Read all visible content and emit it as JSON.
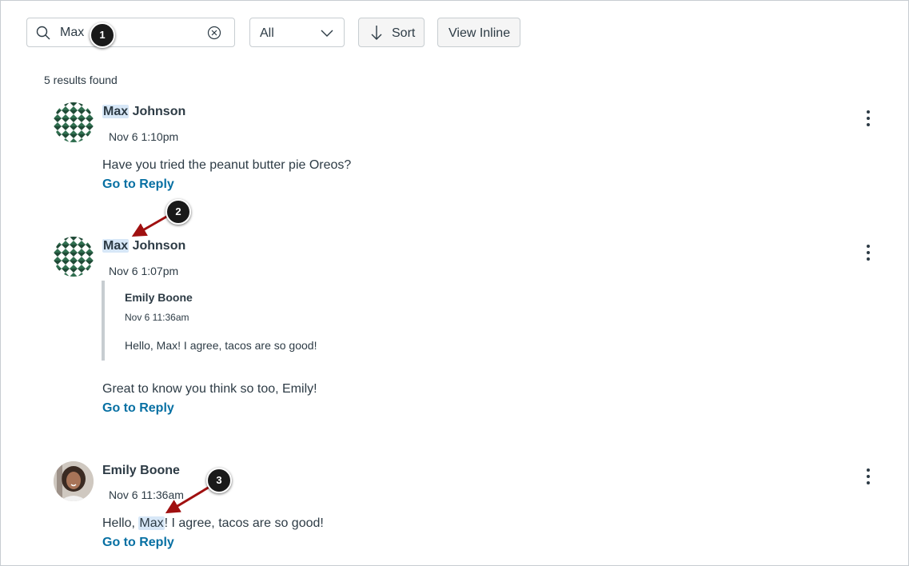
{
  "toolbar": {
    "search_value": "Max",
    "filter_selected": "All",
    "sort_label": "Sort",
    "view_inline_label": "View Inline"
  },
  "results_count": "5 results found",
  "entries": [
    {
      "author_highlight": "Max",
      "author_rest": " Johnson",
      "date": "Nov 6 1:10pm",
      "message": "Have you tried the peanut butter pie Oreos?",
      "reply_link": "Go to Reply"
    },
    {
      "author_highlight": "Max",
      "author_rest": " Johnson",
      "date": "Nov 6 1:07pm",
      "quote": {
        "author": "Emily Boone",
        "date": "Nov 6 11:36am",
        "text": "Hello, Max! I agree, tacos are so good!"
      },
      "message": "Great to know you think so too, Emily!",
      "reply_link": "Go to Reply"
    },
    {
      "author": "Emily Boone",
      "date": "Nov 6 11:36am",
      "message_before": "Hello, ",
      "message_highlight": "Max",
      "message_after": "! I agree, tacos are so good!",
      "reply_link": "Go to Reply"
    }
  ],
  "callouts": [
    "1",
    "2",
    "3"
  ],
  "icons": {
    "search": "search-icon",
    "clear": "clear-icon",
    "dropdown": "chevron-down-icon",
    "sort": "arrow-down-icon",
    "more": "more-vertical-icon"
  },
  "colors": {
    "link": "#0770a3",
    "highlight": "#d7e7f7",
    "annotation_arrow": "#a01010"
  }
}
